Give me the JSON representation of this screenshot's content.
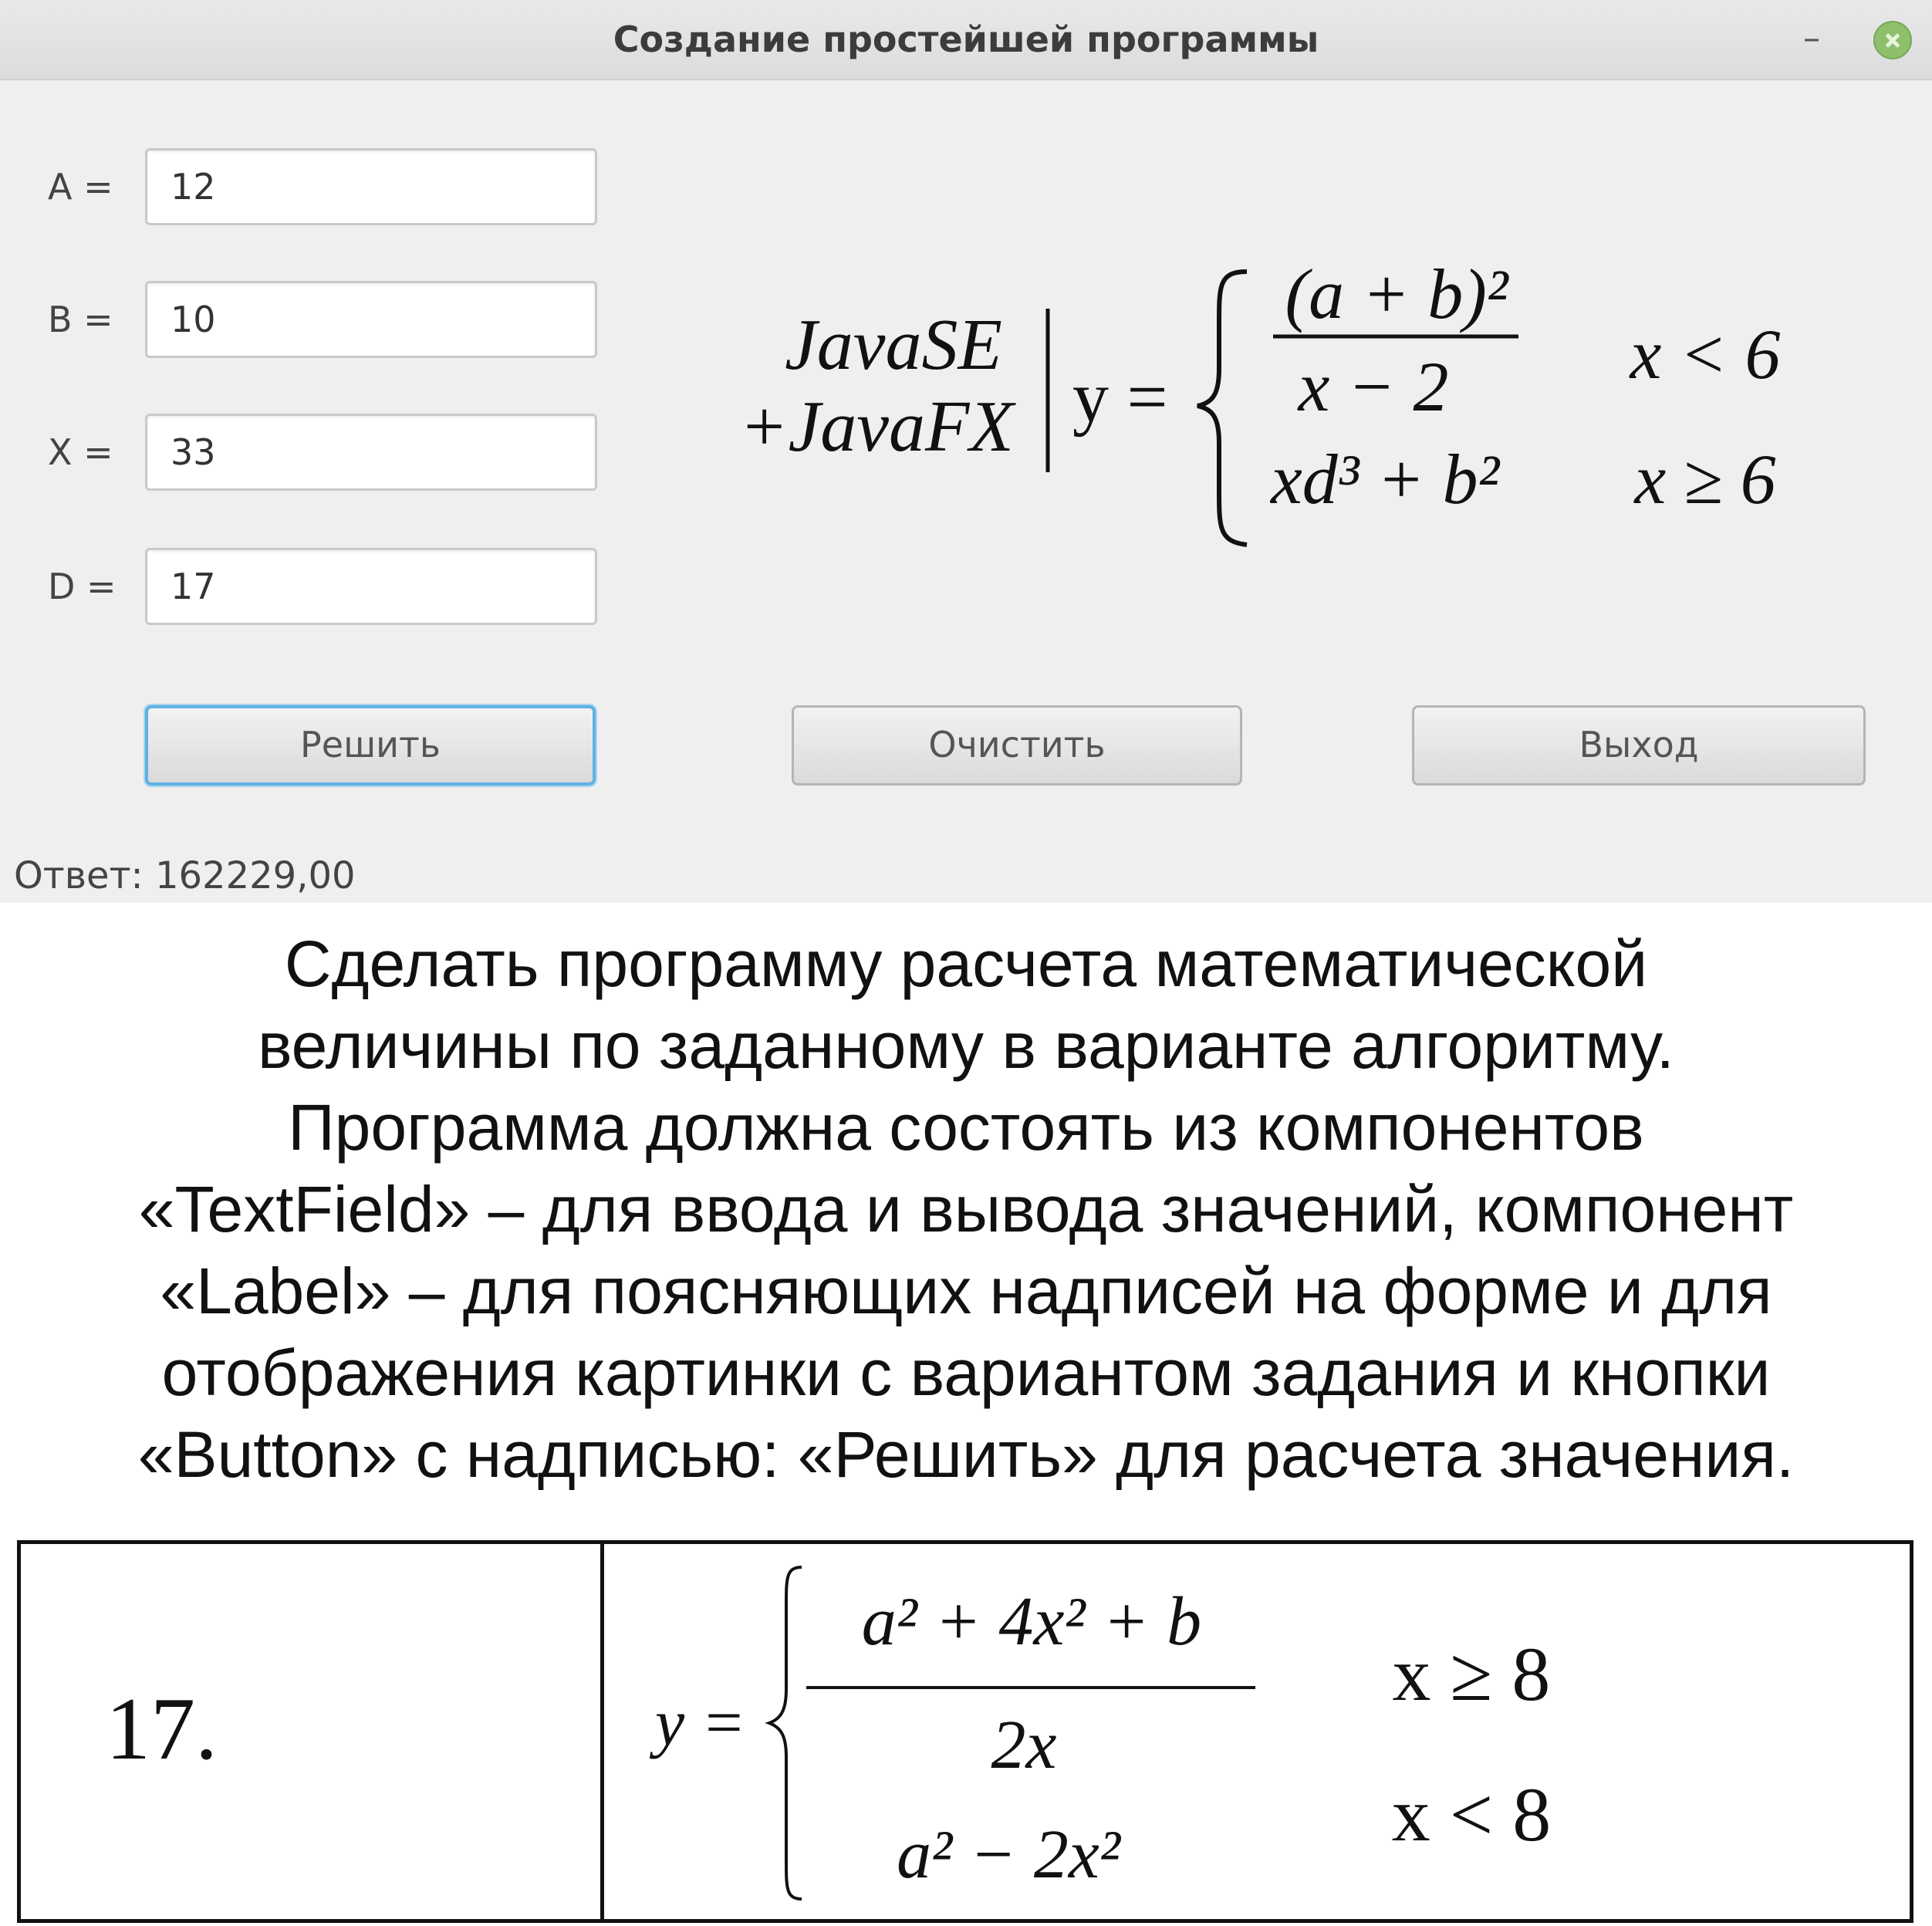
{
  "window": {
    "title": "Создание простейшей программы",
    "minimize_glyph": "–",
    "controls": {
      "minimize_icon": "minimize-icon",
      "close_icon": "close-icon",
      "close_color": "#8ec06c"
    }
  },
  "fields": [
    {
      "label": "A =",
      "value": "12"
    },
    {
      "label": "B =",
      "value": "10"
    },
    {
      "label": "X =",
      "value": "33"
    },
    {
      "label": "D =",
      "value": "17"
    }
  ],
  "buttons": {
    "solve": "Решить",
    "clear": "Очистить",
    "exit": "Выход",
    "focus_color": "#5fb1e3"
  },
  "answer": "Ответ: 162229,00",
  "formula_image": {
    "line1": "JavaSE",
    "line2": "+JavaFX",
    "lhs": "y =",
    "case1_numerator": "(a + b)²",
    "case1_denominator": "x − 2",
    "case1_condition": "x < 6",
    "case2_expression": "xd³ + b²",
    "case2_condition": "x ≥ 6"
  },
  "task": {
    "lines": [
      "Сделать программу расчета математической",
      "величины по заданному в варианте алгоритму.",
      "Программа должна состоять из компонентов",
      "«TextField» – для ввода и вывода значений, компонент",
      "«Label» – для поясняющих надписей на форме и для",
      "отображения картинки с вариантом задания и кнопки",
      "«Button» с надписью: «Решить» для расчета значения."
    ]
  },
  "variant": {
    "number": "17.",
    "lhs": "y =",
    "case1_numerator": "a² + 4x² + b",
    "case1_denominator": "2x",
    "case1_condition": "x ≥ 8",
    "case2_expression": "a² − 2x²",
    "case2_condition": "x < 8"
  }
}
